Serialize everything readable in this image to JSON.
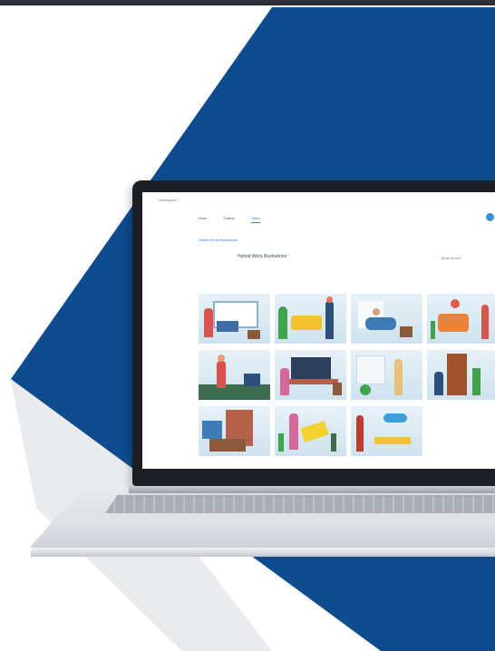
{
  "app": {
    "site_name": "Workspace",
    "nav_tabs": [
      "Work",
      "Gallery",
      "Team"
    ],
    "active_tab": 2,
    "breadcrumb": "Hybrid Work Illustrations",
    "gallery_title": "Hybrid Work Illustrations",
    "sort_label": "Most recent"
  },
  "gallery": {
    "items": [
      {
        "name": "video call illustration"
      },
      {
        "name": "couch with plant illustration"
      },
      {
        "name": "relaxing at home illustration"
      },
      {
        "name": "orange sofa illustration"
      },
      {
        "name": "standing person illustration"
      },
      {
        "name": "desk with monitor illustration"
      },
      {
        "name": "window view illustration"
      },
      {
        "name": "bookshelf illustration"
      },
      {
        "name": "bookshelf room illustration"
      },
      {
        "name": "carrying yellow box illustration"
      },
      {
        "name": "home office desk illustration"
      }
    ]
  },
  "colors": {
    "navy": "#0e4b8f",
    "accent": "#2f7fd2",
    "frame": "#1c1f24"
  }
}
